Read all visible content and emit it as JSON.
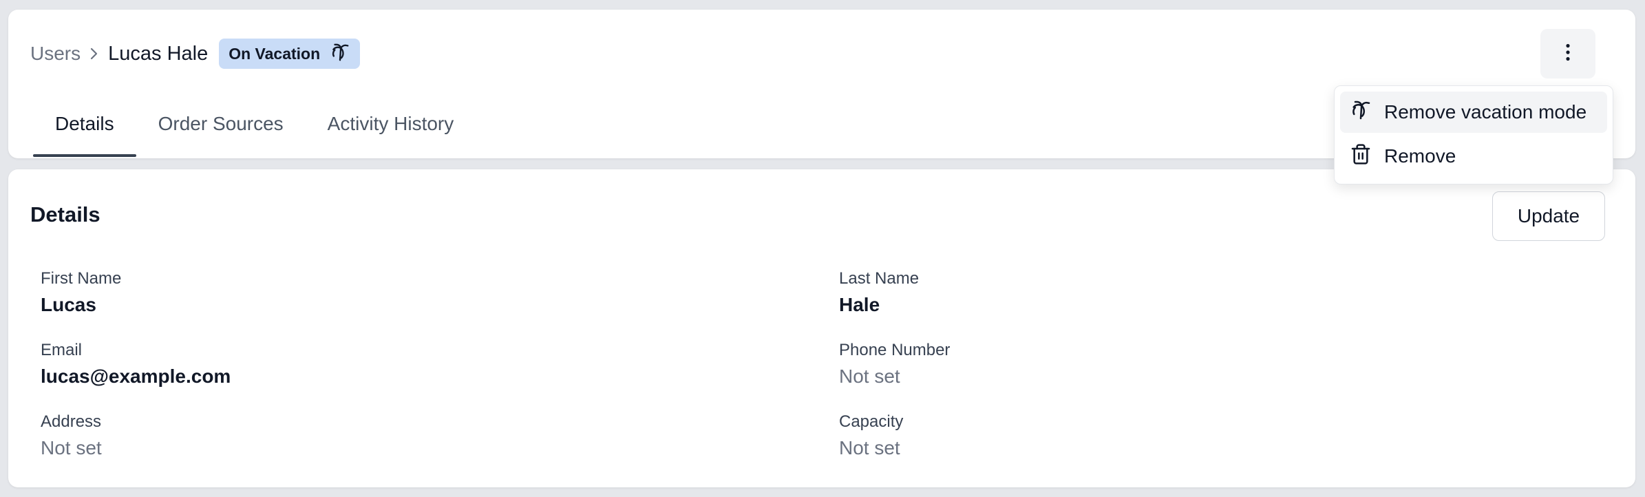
{
  "breadcrumb": {
    "parent": "Users",
    "current": "Lucas Hale",
    "badge": {
      "label": "On Vacation",
      "icon": "palm-tree-icon",
      "bg_color": "#c9dcf7"
    }
  },
  "tabs": [
    {
      "label": "Details",
      "active": true
    },
    {
      "label": "Order Sources",
      "active": false
    },
    {
      "label": "Activity History",
      "active": false
    }
  ],
  "actions_menu": {
    "trigger_icon": "more-vertical-icon",
    "items": [
      {
        "label": "Remove vacation mode",
        "icon": "palm-tree-icon"
      },
      {
        "label": "Remove",
        "icon": "trash-icon"
      }
    ]
  },
  "details": {
    "title": "Details",
    "update_label": "Update",
    "fields": {
      "first_name": {
        "label": "First Name",
        "value": "Lucas"
      },
      "last_name": {
        "label": "Last Name",
        "value": "Hale"
      },
      "email": {
        "label": "Email",
        "value": "lucas@example.com"
      },
      "phone": {
        "label": "Phone Number",
        "value": "Not set"
      },
      "address": {
        "label": "Address",
        "value": "Not set"
      },
      "capacity": {
        "label": "Capacity",
        "value": "Not set"
      }
    }
  }
}
